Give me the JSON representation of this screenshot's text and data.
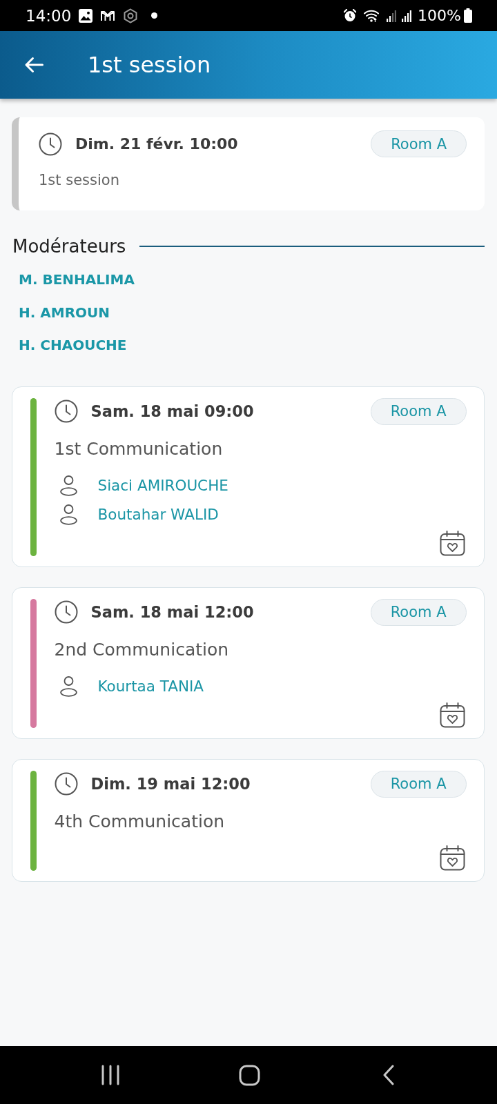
{
  "status_bar": {
    "time": "14:00",
    "battery": "100%"
  },
  "header": {
    "title": "1st session"
  },
  "session": {
    "time": "Dim. 21 févr. 10:00",
    "room": "Room A",
    "title": "1st session"
  },
  "moderators": {
    "heading": "Modérateurs",
    "names": [
      "M. BENHALIMA",
      "H. AMROUN",
      "H. CHAOUCHE"
    ]
  },
  "communications": [
    {
      "time": "Sam. 18 mai 09:00",
      "room": "Room A",
      "title": "1st Communication",
      "color": "#6cb33f",
      "speakers": [
        "Siaci AMIROUCHE",
        "Boutahar WALID"
      ]
    },
    {
      "time": "Sam. 18 mai 12:00",
      "room": "Room A",
      "title": "2nd Communication",
      "color": "#d6799f",
      "speakers": [
        "Kourtaa TANIA"
      ]
    },
    {
      "time": "Dim. 19 mai 12:00",
      "room": "Room A",
      "title": "4th Communication",
      "color": "#6cb33f"
    }
  ]
}
